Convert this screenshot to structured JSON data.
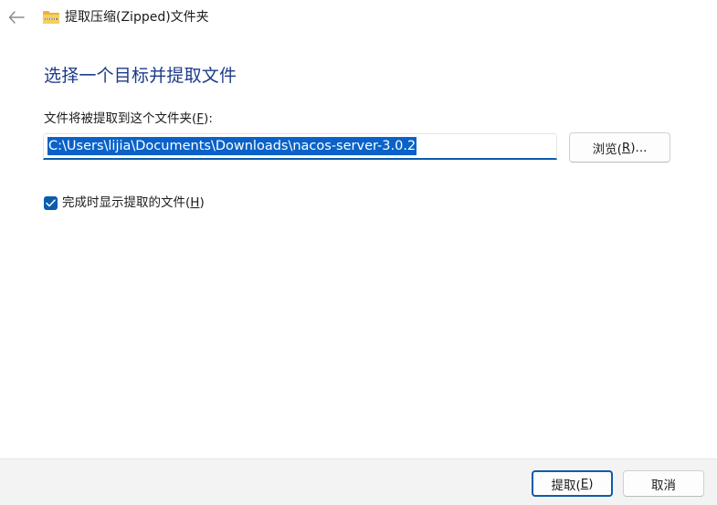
{
  "window": {
    "title": "提取压缩(Zipped)文件夹",
    "back_icon": "arrow-left-icon",
    "zip_icon": "zip-folder-icon"
  },
  "heading": "选择一个目标并提取文件",
  "destination": {
    "label_before": "文件将被提取到这个文件夹(",
    "label_accel": "F",
    "label_after": "):",
    "path_value": "C:\\Users\\lijia\\Documents\\Downloads\\nacos-server-3.0.2",
    "browse_before": "浏览(",
    "browse_accel": "R",
    "browse_after": ")..."
  },
  "show_files": {
    "checked": true,
    "label_before": "完成时显示提取的文件(",
    "label_accel": "H",
    "label_after": ")"
  },
  "footer": {
    "extract_before": "提取(",
    "extract_accel": "E",
    "extract_after": ")",
    "cancel_label": "取消"
  },
  "colors": {
    "accent": "#0b5cad",
    "heading": "#1e3b8a",
    "selection": "#0a62c9",
    "footer_bg": "#f3f3f3"
  }
}
